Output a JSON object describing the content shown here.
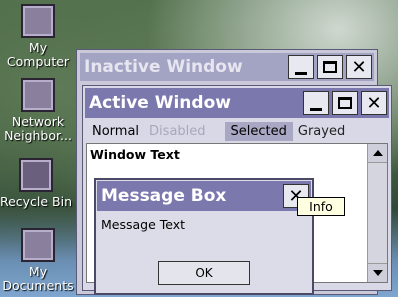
{
  "desktop": {
    "icons": [
      {
        "label": "My\nComputer",
        "icon": "computer-icon"
      },
      {
        "label": "Network\nNeighbor...",
        "icon": "network-icon"
      },
      {
        "label": "Recycle Bin",
        "icon": "recycle-bin-icon"
      },
      {
        "label": "My\nDocuments",
        "icon": "documents-icon"
      }
    ]
  },
  "inactive_window": {
    "title": "Inactive Window"
  },
  "active_window": {
    "title": "Active Window",
    "menu": {
      "normal": "Normal",
      "disabled": "Disabled",
      "selected": "Selected",
      "grayed": "Grayed"
    },
    "text": "Window Text"
  },
  "message_box": {
    "title": "Message Box",
    "text": "Message Text",
    "ok_label": "OK",
    "tooltip": "Info"
  },
  "colors": {
    "inactive_title_bg": "#a3a3c4",
    "active_title_bg": "#7a78ad",
    "window_bg": "#d8d8e6",
    "selected_bg": "#a8a8c4",
    "tooltip_bg": "#ffffe1"
  }
}
